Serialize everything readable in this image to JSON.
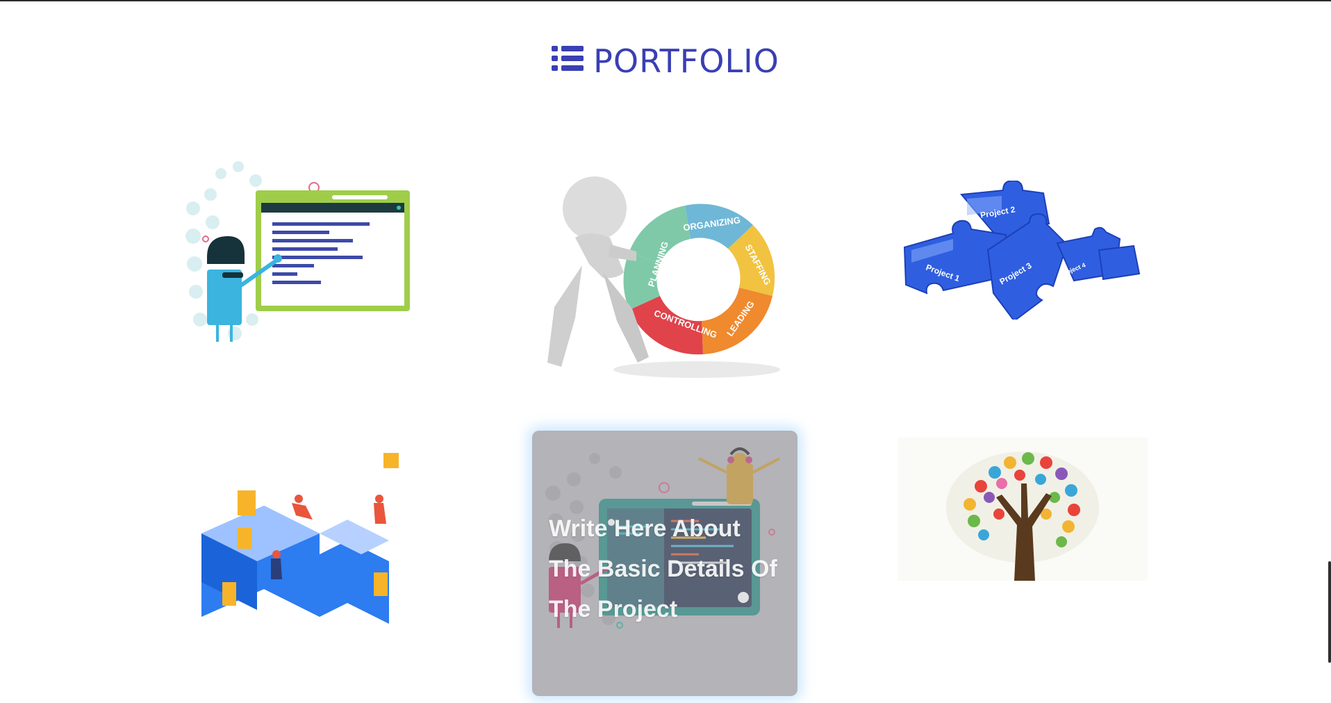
{
  "section": {
    "title": "PORTFOLIO",
    "icon": "list-icon",
    "accent": "#3a3fb3"
  },
  "portfolio_items": [
    {
      "name": "presentation-illustration"
    },
    {
      "name": "management-wheel",
      "labels": [
        "ORGANIZING",
        "STAFFING",
        "LEADING",
        "CONTROLLING",
        "PLANNING"
      ]
    },
    {
      "name": "puzzle-projects",
      "labels": [
        "Project 2",
        "Project 1",
        "Project 3",
        "Project 4"
      ]
    },
    {
      "name": "isometric-team-illustration"
    },
    {
      "name": "coding-illustration",
      "overlay_text": "Write Here About The Basic Details Of The Project"
    },
    {
      "name": "hands-tree-illustration"
    }
  ]
}
